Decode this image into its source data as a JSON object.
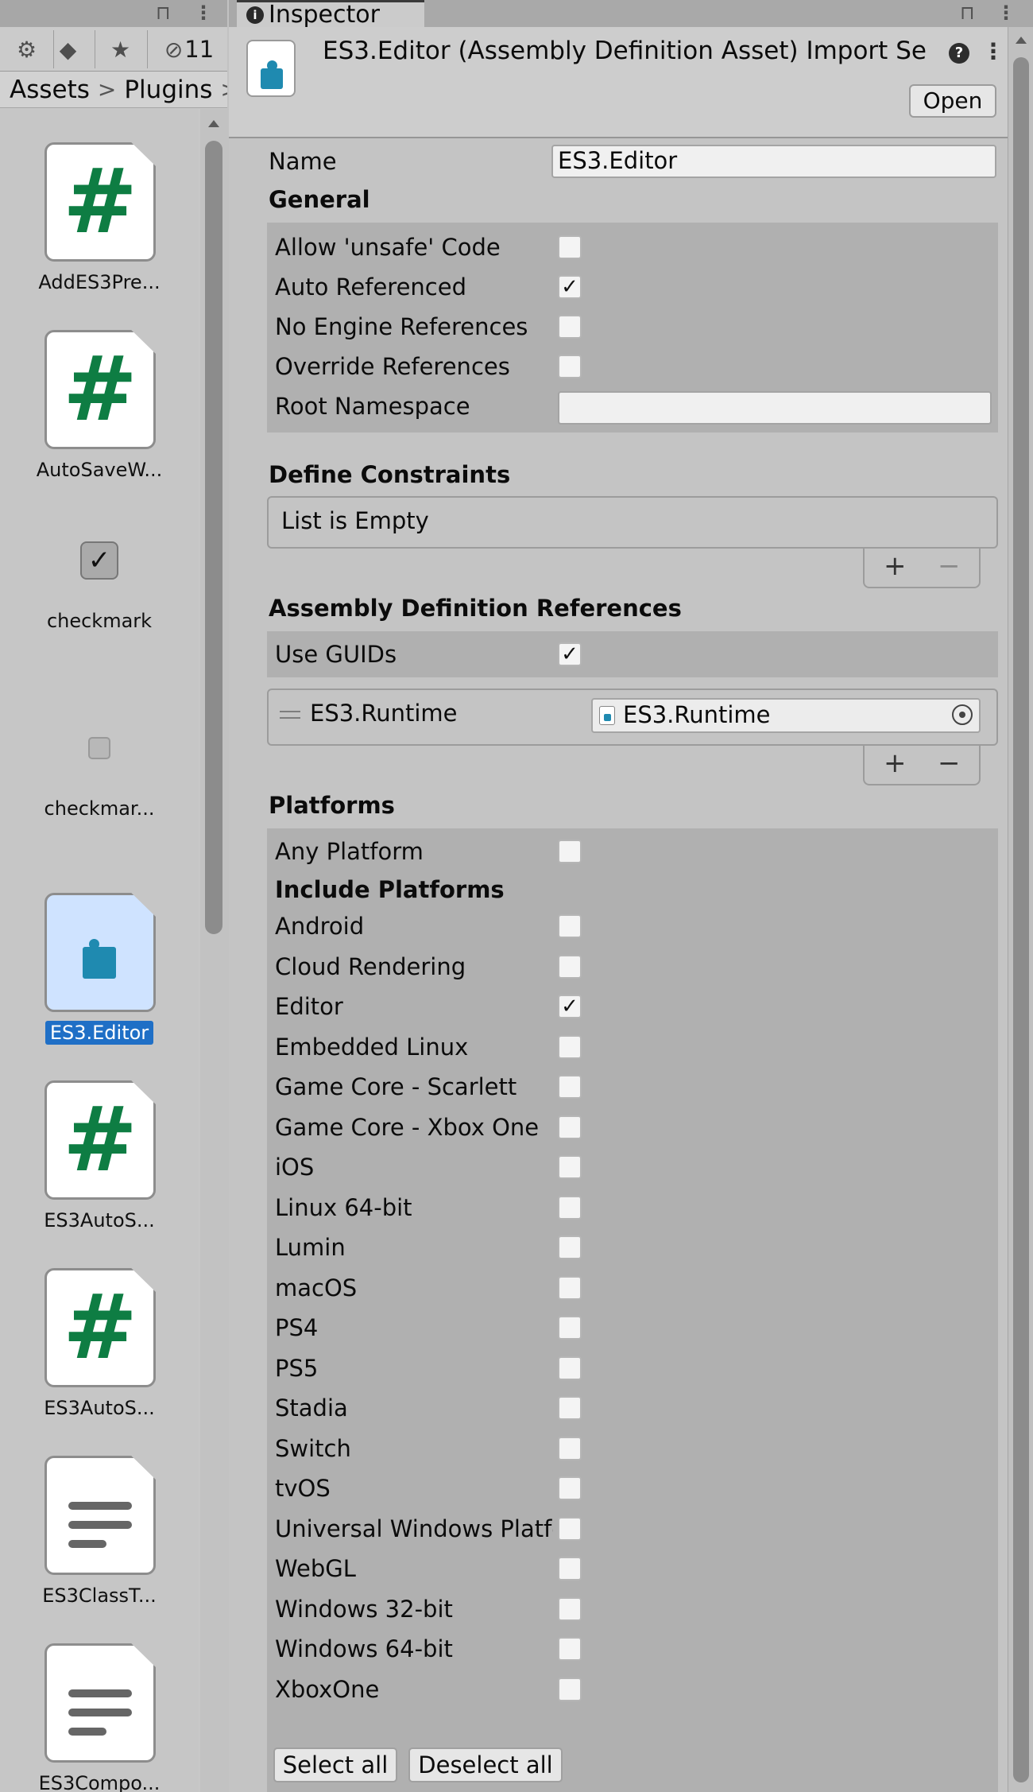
{
  "project": {
    "toolbar_count": "11",
    "breadcrumb": [
      "Assets",
      "Plugins"
    ],
    "assets": [
      {
        "name": "AddES3Pre...",
        "icon": "csharp-script-icon"
      },
      {
        "name": "AutoSaveW...",
        "icon": "csharp-script-icon"
      },
      {
        "name": "checkmark",
        "icon": "texture-icon"
      },
      {
        "name": "checkmar...",
        "icon": "texture-icon"
      },
      {
        "name": "ES3.Editor",
        "icon": "assembly-definition-icon",
        "selected": true
      },
      {
        "name": "ES3AutoS...",
        "icon": "csharp-script-icon"
      },
      {
        "name": "ES3AutoS...",
        "icon": "csharp-script-icon"
      },
      {
        "name": "ES3ClassT...",
        "icon": "text-file-icon"
      },
      {
        "name": "ES3Compo...",
        "icon": "text-file-icon"
      }
    ]
  },
  "inspector": {
    "tab_label": "Inspector",
    "title": "ES3.Editor (Assembly Definition Asset) Import Se",
    "open_label": "Open",
    "name_label": "Name",
    "name_value": "ES3.Editor",
    "general": {
      "heading": "General",
      "rows": [
        {
          "label": "Allow 'unsafe' Code",
          "checked": false
        },
        {
          "label": "Auto Referenced",
          "checked": true
        },
        {
          "label": "No Engine References",
          "checked": false
        },
        {
          "label": "Override References",
          "checked": false
        }
      ],
      "root_namespace_label": "Root Namespace",
      "root_namespace_value": ""
    },
    "define_constraints": {
      "heading": "Define Constraints",
      "empty_label": "List is Empty"
    },
    "assembly_refs": {
      "heading": "Assembly Definition References",
      "use_guids_label": "Use GUIDs",
      "use_guids_checked": true,
      "items": [
        {
          "label": "ES3.Runtime",
          "value": "ES3.Runtime"
        }
      ]
    },
    "platforms": {
      "heading": "Platforms",
      "any_label": "Any Platform",
      "any_checked": false,
      "include_heading": "Include Platforms",
      "items": [
        {
          "label": "Android",
          "checked": false
        },
        {
          "label": "Cloud Rendering",
          "checked": false
        },
        {
          "label": "Editor",
          "checked": true
        },
        {
          "label": "Embedded Linux",
          "checked": false
        },
        {
          "label": "Game Core - Scarlett",
          "checked": false
        },
        {
          "label": "Game Core - Xbox One",
          "checked": false
        },
        {
          "label": "iOS",
          "checked": false
        },
        {
          "label": "Linux 64-bit",
          "checked": false
        },
        {
          "label": "Lumin",
          "checked": false
        },
        {
          "label": "macOS",
          "checked": false
        },
        {
          "label": "PS4",
          "checked": false
        },
        {
          "label": "PS5",
          "checked": false
        },
        {
          "label": "Stadia",
          "checked": false
        },
        {
          "label": "Switch",
          "checked": false
        },
        {
          "label": "tvOS",
          "checked": false
        },
        {
          "label": "Universal Windows Platfo",
          "checked": false
        },
        {
          "label": "WebGL",
          "checked": false
        },
        {
          "label": "Windows 32-bit",
          "checked": false
        },
        {
          "label": "Windows 64-bit",
          "checked": false
        },
        {
          "label": "XboxOne",
          "checked": false
        }
      ],
      "select_all_label": "Select all",
      "deselect_all_label": "Deselect all"
    }
  },
  "glyphs": {
    "check": "✓",
    "hash": "#",
    "plus": "+",
    "minus": "−",
    "kebab": "⋮",
    "help": "?",
    "info": "i",
    "chevron": ">",
    "lock": "🔓"
  }
}
